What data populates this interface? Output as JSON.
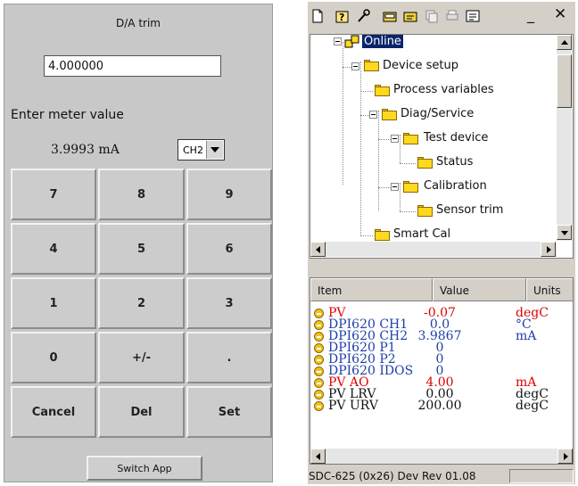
{
  "trim": {
    "title": "D/A trim",
    "value": "4.000000",
    "prompt": "Enter meter value",
    "reading": "3.9993 mA",
    "channel": "CH2",
    "keys": [
      "7",
      "8",
      "9",
      "4",
      "5",
      "6",
      "1",
      "2",
      "3",
      "0",
      "+/-",
      ".",
      "Cancel",
      "Del",
      "Set"
    ],
    "switch_label": "Switch App"
  },
  "toolbar": {
    "icons": [
      "new-doc-icon",
      "help-icon",
      "tools-icon",
      "device-icon",
      "device-settings-icon",
      "copy-icon",
      "print-icon",
      "settings-icon"
    ],
    "minimize": "_",
    "close": "✕"
  },
  "tree": {
    "nodes": [
      {
        "label": "Online",
        "selected": true
      },
      {
        "label": "Device setup"
      },
      {
        "label": "Process variables"
      },
      {
        "label": "Diag/Service"
      },
      {
        "label": "Test device"
      },
      {
        "label": "Status"
      },
      {
        "label": "Calibration"
      },
      {
        "label": "Sensor trim"
      },
      {
        "label": "Smart Cal"
      }
    ]
  },
  "table": {
    "headers": {
      "item": "Item",
      "value": "Value",
      "units": "Units"
    },
    "colors": {
      "red": "#e00000",
      "blue": "#1f3fa8",
      "black": "#111111"
    },
    "rows": [
      {
        "item": "PV",
        "value": "-0.07",
        "units": "degC",
        "color": "red"
      },
      {
        "item": "DPI620 CH1",
        "value": "0.0",
        "units": "°C",
        "color": "blue"
      },
      {
        "item": "DPI620 CH2",
        "value": "3.9867",
        "units": "mA",
        "color": "blue"
      },
      {
        "item": "DPI620 P1",
        "value": "0",
        "units": "",
        "color": "blue"
      },
      {
        "item": "DPI620 P2",
        "value": "0",
        "units": "",
        "color": "blue"
      },
      {
        "item": "DPI620 IDOS",
        "value": "0",
        "units": "",
        "color": "blue"
      },
      {
        "item": "PV AO",
        "value": "4.00",
        "units": "mA",
        "color": "red"
      },
      {
        "item": "PV LRV",
        "value": "0.00",
        "units": "degC",
        "color": "black"
      },
      {
        "item": "PV URV",
        "value": "200.00",
        "units": "degC",
        "color": "black"
      }
    ]
  },
  "status": {
    "text": "SDC-625   (0x26)  Dev Rev 01.08"
  }
}
